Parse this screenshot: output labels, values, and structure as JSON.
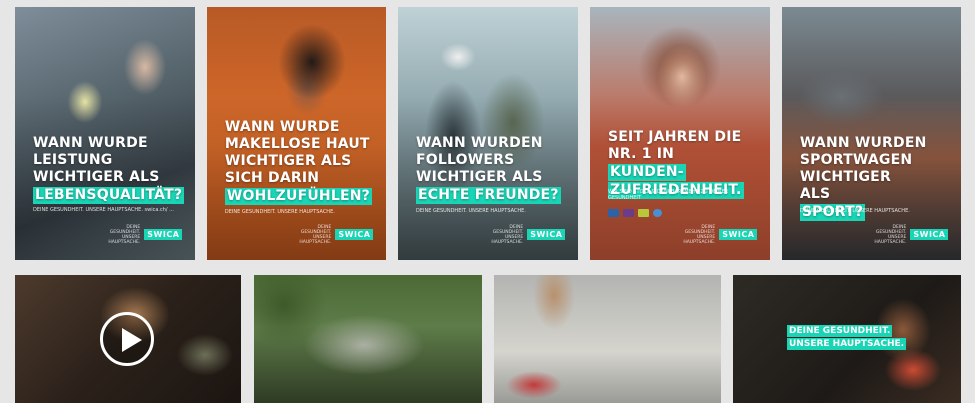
{
  "colors": {
    "accent": "#19d4b5",
    "background": "#e6e6e6"
  },
  "brand": {
    "logo": "SWICA",
    "claim": "DEINE GESUNDHEIT. UNSERE HAUPTSACHE."
  },
  "posters": [
    {
      "lines": [
        "WANN WURDE",
        "LEISTUNG",
        "WICHTIGER ALS"
      ],
      "highlight": "LEBENSQUALITÄT?",
      "sub": "DEINE GESUNDHEIT. UNSERE HAUPTSACHE. swica.ch/ ..."
    },
    {
      "lines": [
        "WANN WURDE",
        "MAKELLOSE HAUT",
        "WICHTIGER ALS",
        "SICH DARIN"
      ],
      "highlight": "WOHLZUFÜHLEN?",
      "sub": "DEINE GESUNDHEIT. UNSERE HAUPTSACHE."
    },
    {
      "lines": [
        "WANN WURDEN",
        "FOLLOWERS",
        "WICHTIGER ALS"
      ],
      "highlight": "ECHTE FREUNDE?",
      "sub": "DEINE GESUNDHEIT. UNSERE HAUPTSACHE."
    },
    {
      "lines": [
        "SEIT JAHREN DIE",
        "NR. 1 IN"
      ],
      "highlight_inline": "KUNDEN-",
      "highlight": "ZUFRIEDENHEIT.",
      "sub": "WIR SIND STOLZ & DANKBAR. MEHR ZU DEINER GESUNDHEIT"
    },
    {
      "lines": [
        "WANN WURDEN",
        "SPORTWAGEN",
        "WICHTIGER"
      ],
      "highlight_prefix": "ALS",
      "highlight": "SPORT?",
      "sub": "DEINE GESUNDHEIT. UNSERE HAUPTSACHE."
    }
  ],
  "videos": {
    "caption_line1": "DEINE GESUNDHEIT.",
    "caption_line2": "UNSERE HAUPTSACHE."
  }
}
